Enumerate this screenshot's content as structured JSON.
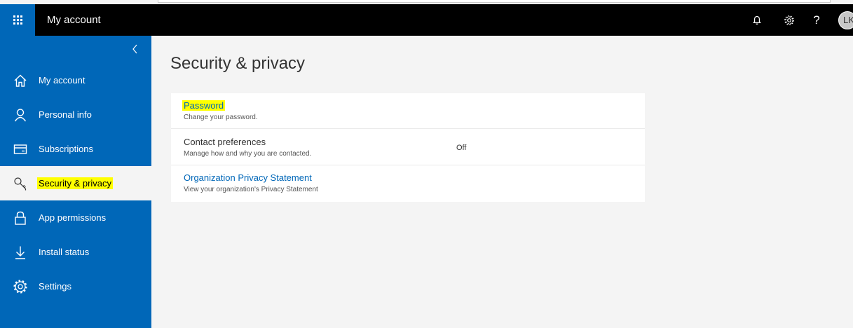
{
  "header": {
    "app_title": "My account",
    "icons": [
      "waffle-icon",
      "bell-icon",
      "gear-icon",
      "help-icon"
    ],
    "help_glyph": "?",
    "avatar_initials": "LK",
    "colors": {
      "bar": "#000000",
      "brand": "#0067b8"
    }
  },
  "sidebar": {
    "collapse_icon": "chevron-left-icon",
    "items": [
      {
        "label": "My account",
        "icon": "home-icon"
      },
      {
        "label": "Personal info",
        "icon": "person-icon"
      },
      {
        "label": "Subscriptions",
        "icon": "card-icon"
      },
      {
        "label": "Security & privacy",
        "icon": "key-icon",
        "active": true
      },
      {
        "label": "App permissions",
        "icon": "lock-icon"
      },
      {
        "label": "Install status",
        "icon": "download-icon"
      },
      {
        "label": "Settings",
        "icon": "gear-icon"
      }
    ]
  },
  "main": {
    "title": "Security & privacy",
    "rows": [
      {
        "title": "Password",
        "description": "Change your password.",
        "status": ""
      },
      {
        "title": "Contact preferences",
        "description": "Manage how and why you are contacted.",
        "status": "Off"
      },
      {
        "title": "Organization Privacy Statement",
        "description": "View your organization's Privacy Statement",
        "status": ""
      }
    ]
  }
}
